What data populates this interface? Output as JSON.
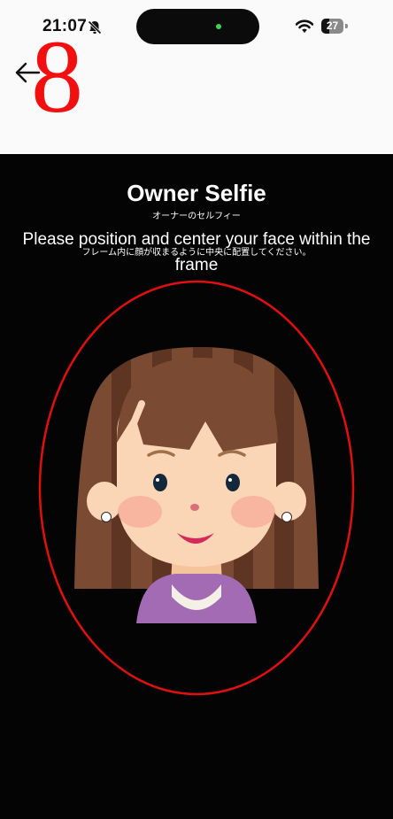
{
  "status_bar": {
    "time": "21:07",
    "battery_level": "27"
  },
  "header": {
    "step_number": "8"
  },
  "selfie": {
    "title": "Owner Selfie",
    "title_jp": "オーナーのセルフィー",
    "instruction": "Please position and center your face within the frame",
    "instruction_jp": "フレーム内に顔が収まるように中央に配置してください。"
  },
  "colors": {
    "accent": "#f20f0f",
    "frame": "#e01010",
    "camera_background": "#040405",
    "header_background": "#fafafa"
  },
  "icons": {
    "back": "back-arrow-icon",
    "silent": "bell-slash-icon",
    "wifi": "wifi-icon",
    "battery": "battery-icon"
  }
}
